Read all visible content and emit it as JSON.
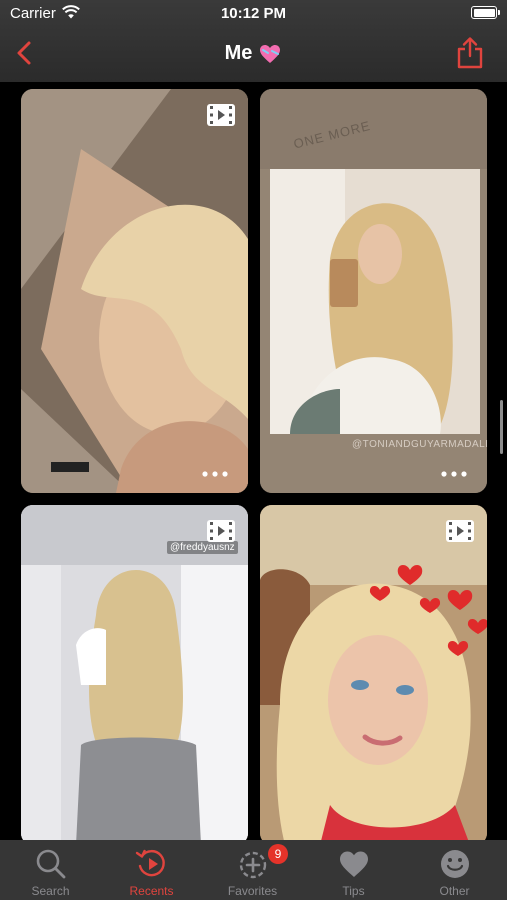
{
  "status_bar": {
    "carrier": "Carrier",
    "time": "10:12 PM"
  },
  "nav": {
    "title": "Me",
    "back_icon": "chevron-left-icon",
    "share_icon": "share-icon"
  },
  "colors": {
    "accent": "#e0443e",
    "tab_inactive": "#8a8a8e",
    "badge": "#e5332a"
  },
  "media": [
    {
      "type": "video",
      "icon": "video-icon",
      "more_icon": "more-icon"
    },
    {
      "type": "photo",
      "caption_top": "ONE MORE",
      "credit": "@TONIANDGUYARMADALE",
      "more_icon": "more-icon"
    },
    {
      "type": "video",
      "icon": "video-icon",
      "credit": "@freddyausnz"
    },
    {
      "type": "video",
      "icon": "video-icon"
    }
  ],
  "tabs": [
    {
      "label": "Search",
      "icon": "magnifier-icon",
      "active": false
    },
    {
      "label": "Recents",
      "icon": "recents-play-icon",
      "active": true
    },
    {
      "label": "Favorites",
      "icon": "favorites-add-icon",
      "active": false,
      "badge": "9"
    },
    {
      "label": "Tips",
      "icon": "heart-icon",
      "active": false
    },
    {
      "label": "Other",
      "icon": "smiley-icon",
      "active": false
    }
  ]
}
